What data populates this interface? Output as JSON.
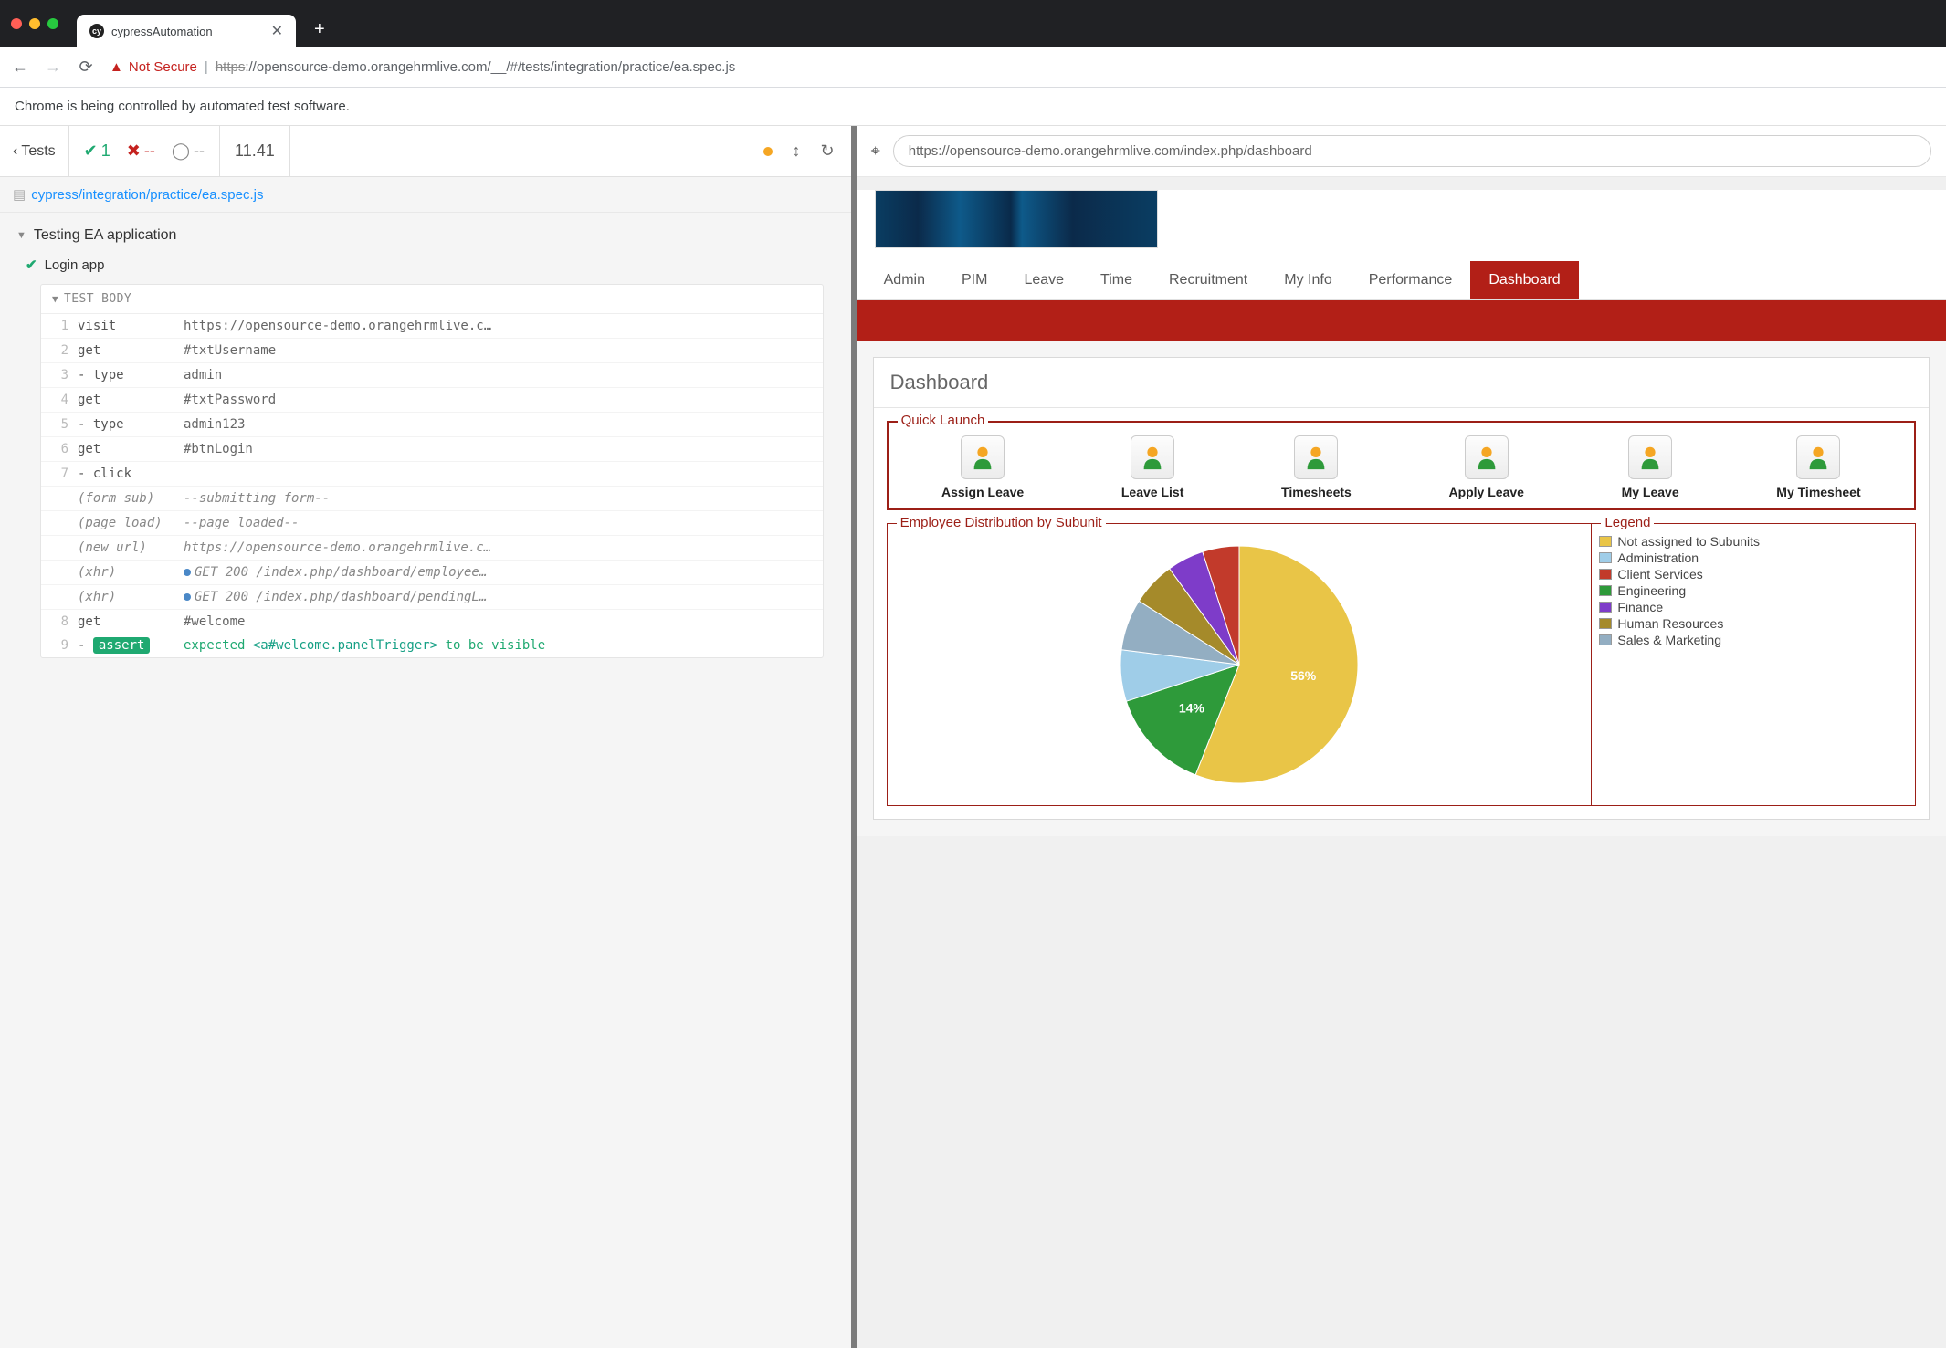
{
  "browser": {
    "tab_title": "cypressAutomation",
    "not_secure_label": "Not Secure",
    "url_scheme": "https",
    "url_rest": "://opensource-demo.orangehrmlive.com/__/#/tests/integration/practice/ea.spec.js",
    "info_bar": "Chrome is being controlled by automated test software."
  },
  "cypress": {
    "tests_btn": "Tests",
    "pass_count": "1",
    "fail_count": "--",
    "pending_count": "--",
    "duration": "11.41",
    "spec_path": "cypress/integration/practice/ea.spec.js",
    "suite_name": "Testing EA application",
    "test_name": "Login app",
    "test_body_label": "TEST BODY",
    "steps": [
      {
        "n": "1",
        "cmd": "visit",
        "val": "https://opensource-demo.orangehrmlive.c…"
      },
      {
        "n": "2",
        "cmd": "get",
        "val": "#txtUsername"
      },
      {
        "n": "3",
        "cmd": " - type",
        "val": "admin"
      },
      {
        "n": "4",
        "cmd": "get",
        "val": "#txtPassword"
      },
      {
        "n": "5",
        "cmd": " - type",
        "val": "admin123"
      },
      {
        "n": "6",
        "cmd": "get",
        "val": "#btnLogin"
      },
      {
        "n": "7",
        "cmd": " - click",
        "val": ""
      },
      {
        "n": "",
        "cmd": "(form sub)",
        "val": "--submitting form--",
        "ital": true
      },
      {
        "n": "",
        "cmd": "(page load)",
        "val": "--page loaded--",
        "ital": true
      },
      {
        "n": "",
        "cmd": "(new url)",
        "val": "https://opensource-demo.orangehrmlive.c…",
        "ital": true
      },
      {
        "n": "",
        "cmd": "(xhr)",
        "val": "GET 200 /index.php/dashboard/employee…",
        "ital": true,
        "xhr": true
      },
      {
        "n": "",
        "cmd": "(xhr)",
        "val": "GET 200 /index.php/dashboard/pendingL…",
        "ital": true,
        "xhr": true
      },
      {
        "n": "8",
        "cmd": "get",
        "val": "#welcome"
      }
    ],
    "assert": {
      "n": "9",
      "cmd_prefix": " - ",
      "pill": "assert",
      "pre": "expected ",
      "selector": "<a#welcome.panelTrigger>",
      "post": " to be visible"
    }
  },
  "preview": {
    "url": "https://opensource-demo.orangehrmlive.com/index.php/dashboard"
  },
  "app": {
    "nav": [
      "Admin",
      "PIM",
      "Leave",
      "Time",
      "Recruitment",
      "My Info",
      "Performance",
      "Dashboard"
    ],
    "active_nav": "Dashboard",
    "dashboard_title": "Dashboard",
    "quick_launch_title": "Quick Launch",
    "quick_launch": [
      "Assign Leave",
      "Leave List",
      "Timesheets",
      "Apply Leave",
      "My Leave",
      "My Timesheet"
    ],
    "chart_title": "Employee Distribution by Subunit",
    "legend_title": "Legend",
    "legend": [
      {
        "label": "Not assigned to Subunits",
        "color": "#e9c547"
      },
      {
        "label": "Administration",
        "color": "#9fcde8"
      },
      {
        "label": "Client Services",
        "color": "#c23a2b"
      },
      {
        "label": "Engineering",
        "color": "#2e9a3a"
      },
      {
        "label": "Finance",
        "color": "#7e3cc9"
      },
      {
        "label": "Human Resources",
        "color": "#a58a2a"
      },
      {
        "label": "Sales & Marketing",
        "color": "#93aec2"
      }
    ]
  },
  "chart_data": {
    "type": "pie",
    "title": "Employee Distribution by Subunit",
    "series": [
      {
        "name": "Not assigned to Subunits",
        "value": 56,
        "color": "#e9c547"
      },
      {
        "name": "Engineering",
        "value": 14,
        "color": "#2e9a3a"
      },
      {
        "name": "Administration",
        "value": 7,
        "color": "#9fcde8"
      },
      {
        "name": "Sales & Marketing",
        "value": 7,
        "color": "#93aec2"
      },
      {
        "name": "Human Resources",
        "value": 6,
        "color": "#a58a2a"
      },
      {
        "name": "Finance",
        "value": 5,
        "color": "#7e3cc9"
      },
      {
        "name": "Client Services",
        "value": 5,
        "color": "#c23a2b"
      }
    ],
    "labels_shown": [
      {
        "name": "Not assigned to Subunits",
        "text": "56%"
      },
      {
        "name": "Engineering",
        "text": "14%"
      }
    ]
  }
}
